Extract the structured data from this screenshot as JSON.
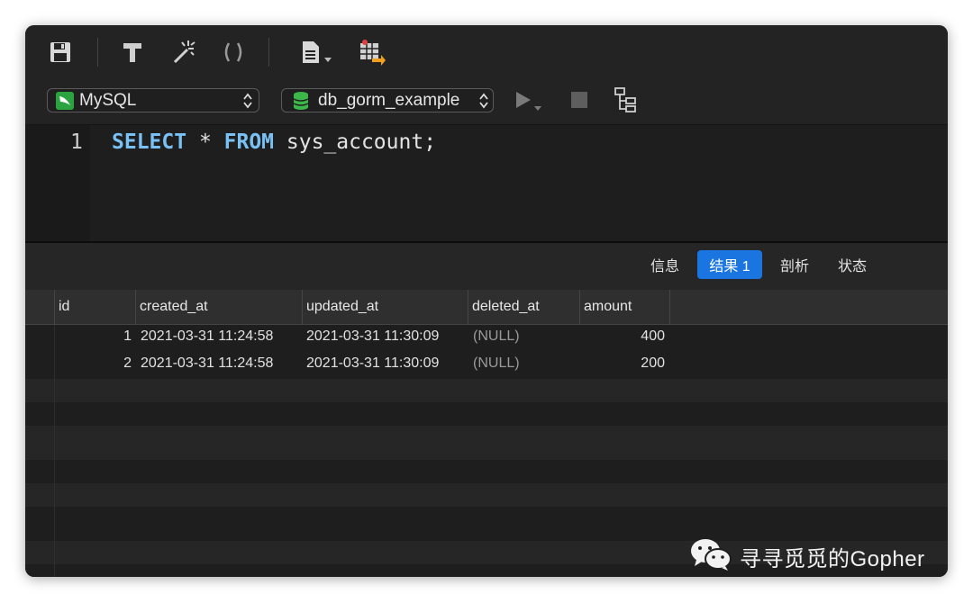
{
  "toolbar": {
    "icons": [
      "save-icon",
      "format-icon",
      "beautify-wand-icon",
      "parentheses-icon",
      "document-icon",
      "export-icon"
    ]
  },
  "connection": {
    "engine_label": "MySQL",
    "database_label": "db_gorm_example"
  },
  "editor": {
    "line_number": "1",
    "keyword_select": "SELECT",
    "star": " * ",
    "keyword_from": "FROM",
    "rest": " sys_account;"
  },
  "result_tabs": [
    {
      "label": "信息",
      "active": false
    },
    {
      "label": "结果 1",
      "active": true
    },
    {
      "label": "剖析",
      "active": false
    },
    {
      "label": "状态",
      "active": false
    }
  ],
  "table": {
    "columns": [
      "id",
      "created_at",
      "updated_at",
      "deleted_at",
      "amount"
    ],
    "rows": [
      {
        "id": "1",
        "created_at": "2021-03-31 11:24:58",
        "updated_at": "2021-03-31 11:30:09",
        "deleted_at": "(NULL)",
        "amount": "400"
      },
      {
        "id": "2",
        "created_at": "2021-03-31 11:24:58",
        "updated_at": "2021-03-31 11:30:09",
        "deleted_at": "(NULL)",
        "amount": "200"
      }
    ]
  },
  "watermark": {
    "text": "寻寻觅觅的Gopher"
  },
  "colors": {
    "accent": "#1a75e0",
    "keyword": "#79c1f5",
    "mysql_icon": "#2aa340",
    "db_icon": "#3cb84a"
  }
}
